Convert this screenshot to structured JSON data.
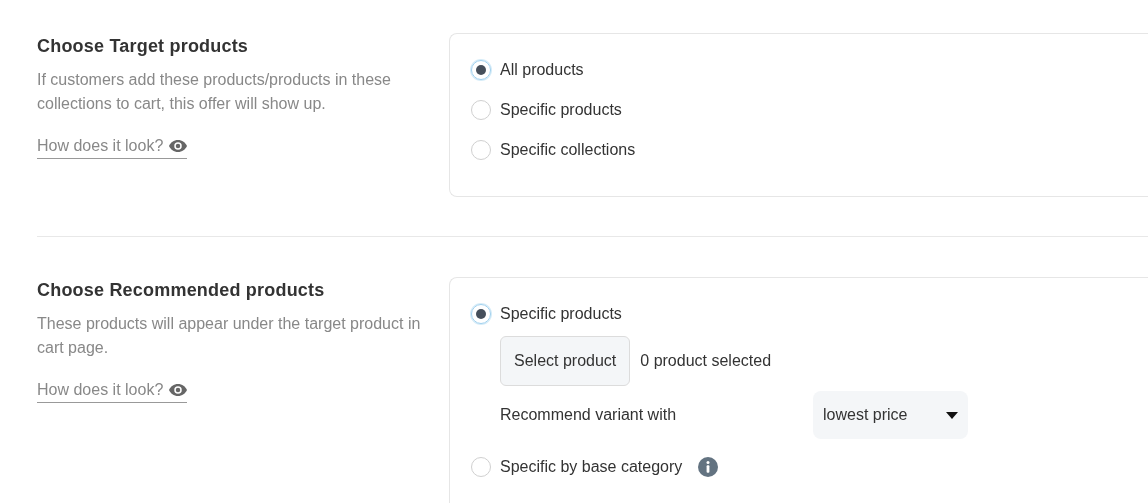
{
  "sections": [
    {
      "title": "Choose Target products",
      "description": "If customers add these products/products in these collections to cart, this offer will show up.",
      "link": "How does it look?",
      "options": [
        {
          "label": "All products",
          "selected": true,
          "info": false
        },
        {
          "label": "Specific products",
          "selected": false,
          "info": false
        },
        {
          "label": "Specific collections",
          "selected": false,
          "info": false
        }
      ]
    },
    {
      "title": "Choose Recommended products",
      "description": "These products will appear under the target product in cart page.",
      "link": "How does it look?",
      "options": [
        {
          "label": "Specific products",
          "selected": true,
          "info": false,
          "button": "Select product",
          "count": "0 product selected",
          "variant_label": "Recommend variant with",
          "variant_value": "lowest price"
        },
        {
          "label": "Specific by base category",
          "selected": false,
          "info": true
        }
      ]
    }
  ]
}
